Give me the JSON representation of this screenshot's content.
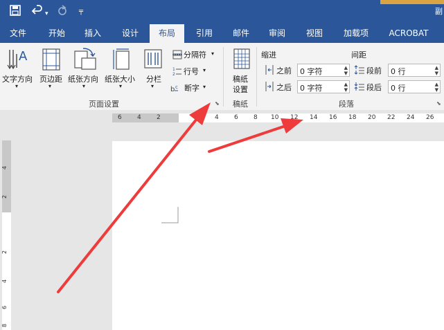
{
  "title_bar": {
    "right_text": "副",
    "qa_icons": [
      "save-icon",
      "undo-icon",
      "redo-icon",
      "customize-icon"
    ]
  },
  "tabs": [
    {
      "label": "文件"
    },
    {
      "label": "开始"
    },
    {
      "label": "插入"
    },
    {
      "label": "设计"
    },
    {
      "label": "布局",
      "active": true
    },
    {
      "label": "引用"
    },
    {
      "label": "邮件"
    },
    {
      "label": "审阅"
    },
    {
      "label": "视图"
    },
    {
      "label": "加载项"
    },
    {
      "label": "ACROBAT"
    }
  ],
  "ribbon": {
    "page_setup": {
      "group_label": "页面设置",
      "text_direction": "文字方向",
      "margins": "页边距",
      "orientation": "纸张方向",
      "size": "纸张大小",
      "columns": "分栏",
      "breaks": "分隔符",
      "line_numbers": "行号",
      "hyphenation": "断字"
    },
    "manuscript": {
      "group_label": "稿纸",
      "button_line1": "稿纸",
      "button_line2": "设置"
    },
    "paragraph": {
      "group_label": "段落",
      "indent_label": "缩进",
      "spacing_label": "间距",
      "indent_left_label": "之前",
      "indent_left_value": "0 字符",
      "indent_right_label": "之后",
      "indent_right_value": "0 字符",
      "spacing_before_label": "段前",
      "spacing_before_value": "0 行",
      "spacing_after_label": "段后",
      "spacing_after_value": "0 行"
    }
  },
  "ruler": {
    "left_numbers": [
      "6",
      "4",
      "2"
    ],
    "numbers": [
      "2",
      "4",
      "6",
      "8",
      "10",
      "12",
      "14",
      "16",
      "18",
      "20",
      "22",
      "24",
      "26"
    ]
  },
  "vruler": {
    "numbers": [
      "4",
      "2",
      "2",
      "4",
      "6",
      "8"
    ]
  },
  "colors": {
    "title_bar": "#2b579a",
    "ribbon": "#f3f3f3",
    "arrow": "#ee3b3b"
  }
}
